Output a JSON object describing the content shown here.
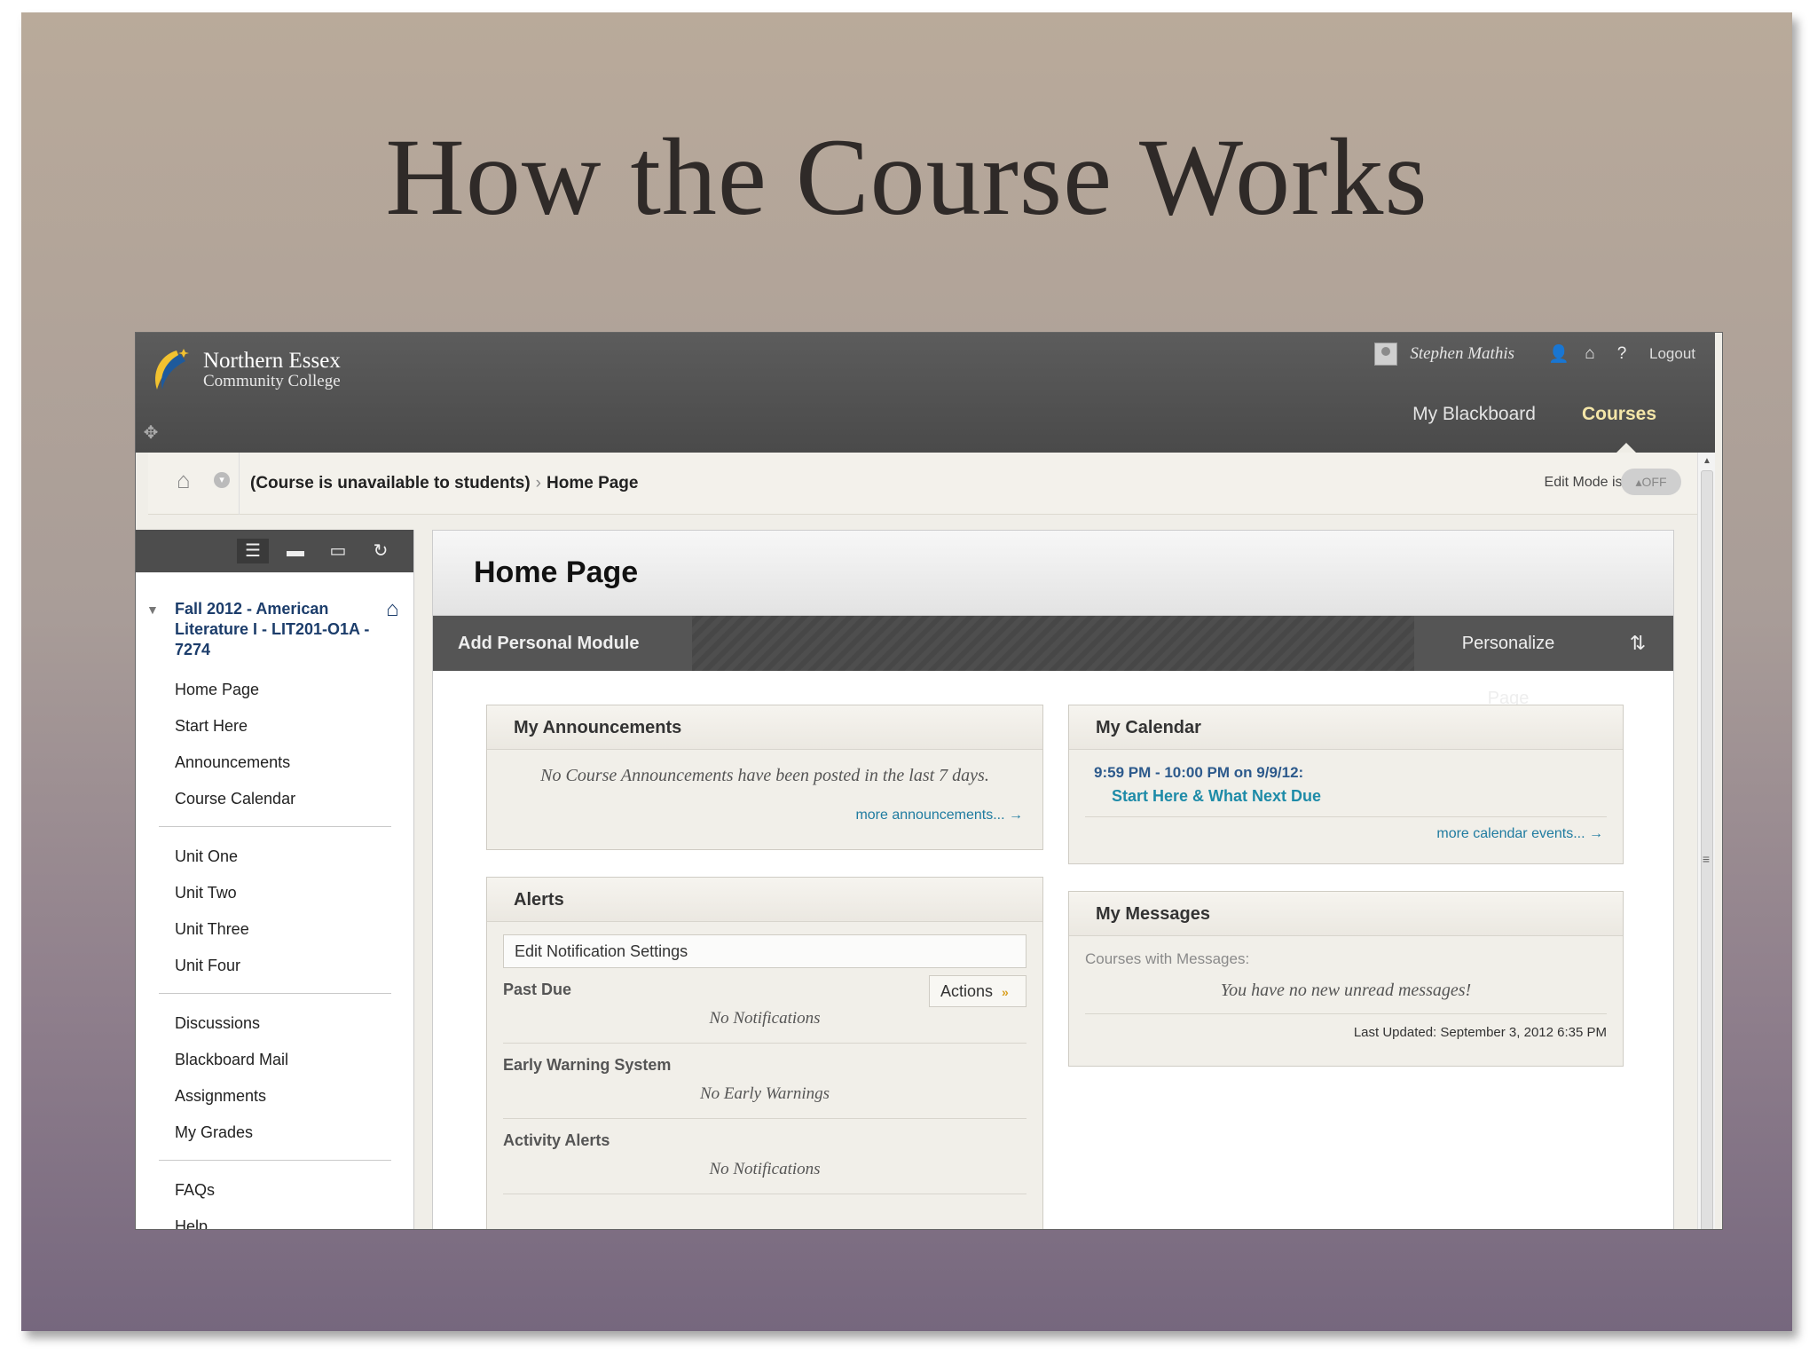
{
  "slide": {
    "title": "How the Course Works"
  },
  "app": {
    "logo_line1": "Northern Essex",
    "logo_line2": "Community College",
    "user_name": "Stephen Mathis",
    "logout": "Logout",
    "tabs": [
      "My Blackboard",
      "Courses"
    ]
  },
  "breadcrumb": {
    "course": "(Course is unavailable to students)",
    "page": "Home Page",
    "edit_mode_label": "Edit Mode is:",
    "edit_mode_value": "OFF"
  },
  "sidebar": {
    "course_title": "Fall 2012 - American Literature I - LIT201-O1A - 7274",
    "group1": [
      "Home Page",
      "Start Here",
      "Announcements",
      "Course Calendar"
    ],
    "group2": [
      "Unit One",
      "Unit Two",
      "Unit Three",
      "Unit Four"
    ],
    "group3": [
      "Discussions",
      "Blackboard Mail",
      "Assignments",
      "My Grades"
    ],
    "group4": [
      "FAQs",
      "Help"
    ]
  },
  "main": {
    "title": "Home Page",
    "add_module": "Add Personal Module",
    "personalize": "Personalize Page",
    "announcements": {
      "title": "My Announcements",
      "empty": "No Course Announcements have been posted in the last 7 days.",
      "more": "more announcements... →"
    },
    "alerts": {
      "title": "Alerts",
      "edit_notifications": "Edit Notification Settings",
      "past_due_label": "Past Due",
      "actions": "Actions",
      "past_due_empty": "No Notifications",
      "early_warning_label": "Early Warning System",
      "early_warning_empty": "No Early Warnings",
      "activity_label": "Activity Alerts",
      "activity_empty": "No Notifications"
    },
    "calendar": {
      "title": "My Calendar",
      "time": "9:59 PM - 10:00 PM on 9/9/12:",
      "event": "Start Here & What Next Due",
      "more": "more calendar events... →"
    },
    "messages": {
      "title": "My Messages",
      "courses_label": "Courses with Messages:",
      "empty": "You have no new unread messages!",
      "updated": "Last Updated: September 3, 2012 6:35 PM"
    }
  },
  "colors": {
    "topbar": "#4a4a4a",
    "active_tab": "#f4e6a8",
    "link": "#1f7ba0",
    "course_title": "#1c3d6b"
  }
}
